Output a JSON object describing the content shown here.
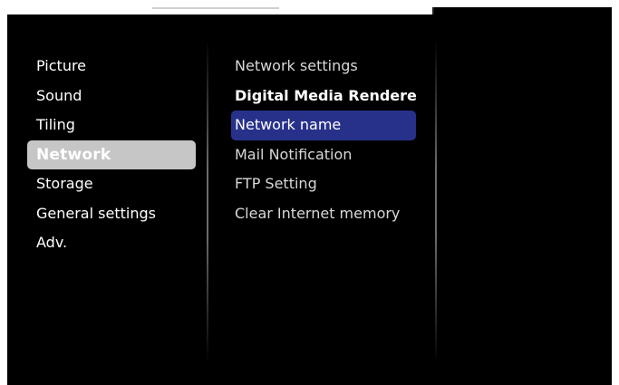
{
  "menu": {
    "items": [
      {
        "label": "Picture"
      },
      {
        "label": "Sound"
      },
      {
        "label": "Tiling"
      },
      {
        "label": "Network"
      },
      {
        "label": "Storage"
      },
      {
        "label": "General settings"
      },
      {
        "label": "Adv."
      }
    ],
    "selected_index": 3
  },
  "submenu": {
    "items": [
      {
        "label": "Network settings"
      },
      {
        "label": "Digital Media Rendere..."
      },
      {
        "label": "Network name"
      },
      {
        "label": "Mail Notification"
      },
      {
        "label": "FTP Setting"
      },
      {
        "label": "Clear Internet memory"
      }
    ],
    "emphasized_index": 1,
    "highlighted_index": 2
  },
  "colors": {
    "background": "#000000",
    "selected_main": "#c6c6c6",
    "highlight_sub": "#27318a",
    "text": "#ffffff"
  }
}
